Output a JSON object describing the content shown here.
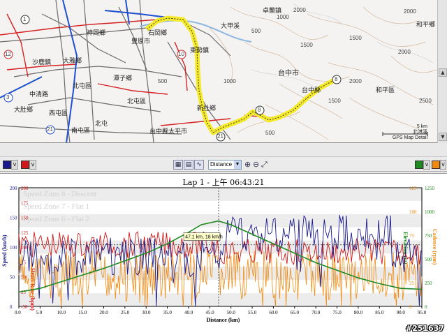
{
  "map": {
    "places": [
      "豐原市",
      "石岡鄉",
      "東勢鎮",
      "新社鄉",
      "台中市",
      "大雅鄉",
      "潭子鄉",
      "北屯區",
      "台中縣太平市",
      "沙鹿鎮",
      "大肚鄉",
      "西屯區",
      "南屯區",
      "神岡鄉",
      "和平鄉",
      "台中縣",
      "卓蘭鎮",
      "大甲溪",
      "北屯區",
      "和平區",
      "北屯",
      "中清路"
    ],
    "route_numbers": [
      "1",
      "3",
      "8",
      "8",
      "21",
      "12",
      "10",
      "21"
    ],
    "contours": [
      "1000",
      "1000",
      "1500",
      "2000",
      "2000",
      "2000",
      "1500",
      "500",
      "500",
      "1500",
      "2000",
      "2500",
      "500"
    ],
    "scale_label": "5 km",
    "scale_sub": "北港溪",
    "credit": "GPS Map Detail"
  },
  "toolbar": {
    "left_swatch_1": "#1a1a8c",
    "left_swatch_2": "#d01818",
    "right_swatch_1": "#1f8a1f",
    "right_swatch_2": "#f08a10",
    "axis_select": "Distance",
    "arrow": "v"
  },
  "chart_data": {
    "type": "line",
    "title": "Lap 1 - 上午 06:43:21",
    "xlabel": "Distance (km)",
    "x_ticks": [
      "0.0",
      "5.0",
      "10.0",
      "15.0",
      "20.0",
      "25.0",
      "30.0",
      "35.0",
      "40.0",
      "45.0",
      "50.0",
      "55.0",
      "60.0",
      "65.0",
      "70.0",
      "75.0",
      "80.0",
      "85.0",
      "90.0",
      "95.0"
    ],
    "xlim": [
      0,
      95
    ],
    "left_axis_speed": {
      "label": "Speed (km/h)",
      "ticks": [
        "0",
        "50",
        "100",
        "150",
        "200"
      ]
    },
    "left_axis_hr": {
      "label": "Heart Rate (bpm)",
      "ticks": [
        "-50",
        "25",
        "50",
        "75",
        "100",
        "125",
        "150",
        "175",
        "200"
      ]
    },
    "right_axis_cadence": {
      "label": "Cadence (rpm)",
      "ticks": [
        "0",
        "25",
        "50",
        "75",
        "100",
        "125"
      ]
    },
    "right_axis_elevation": {
      "label": "Elevation (m)",
      "ticks": [
        "0",
        "250",
        "500",
        "750",
        "1000",
        "1250"
      ]
    },
    "zones": [
      "Speed Zone 8 - Descent",
      "Speed Zone 7 - Flat 1",
      "Speed Zone 6 - Flat 2"
    ],
    "tooltip": "47.1 km, 18 km/h",
    "series": [
      {
        "name": "Elevation",
        "color": "#1f8a1f",
        "x": [
          0,
          5,
          10,
          15,
          20,
          25,
          30,
          35,
          40,
          43,
          47,
          50,
          55,
          60,
          65,
          70,
          75,
          80,
          85,
          90,
          95
        ],
        "y": [
          150,
          190,
          260,
          330,
          400,
          480,
          560,
          660,
          780,
          860,
          900,
          860,
          760,
          660,
          560,
          460,
          380,
          300,
          240,
          190,
          180
        ]
      }
    ]
  },
  "watermark": "#251637"
}
